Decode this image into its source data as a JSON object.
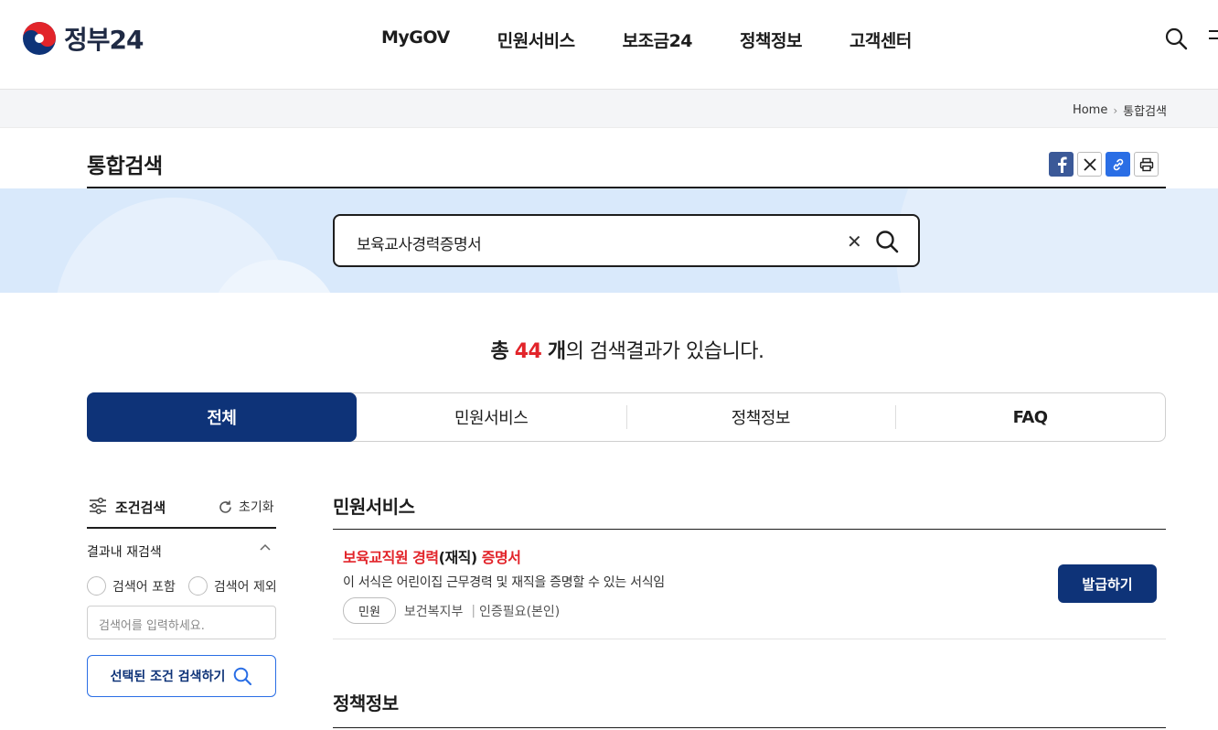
{
  "header": {
    "logo_text": "정부24",
    "nav": [
      "MyGOV",
      "민원서비스",
      "보조금24",
      "정책정보",
      "고객센터"
    ]
  },
  "breadcrumb": {
    "home": "Home",
    "current": "통합검색"
  },
  "page": {
    "title": "통합검색"
  },
  "search": {
    "query": "보육교사경력증명서"
  },
  "summary": {
    "prefix": "총",
    "count": "44",
    "unit": "개",
    "suffix": "의 검색결과가 있습니다."
  },
  "tabs": [
    "전체",
    "민원서비스",
    "정책정보",
    "FAQ"
  ],
  "sidebar": {
    "title": "조건검색",
    "reset": "초기화",
    "research_title": "결과내 재검색",
    "radio_include": "검색어 포함",
    "radio_exclude": "검색어 제외",
    "input_placeholder": "검색어를 입력하세요.",
    "search_button": "선택된 조건 검색하기"
  },
  "results": {
    "section_civil": "민원서비스",
    "item": {
      "title_part1": "보육교직원 경력",
      "title_part2": "(재직)",
      "title_part3": "증명서",
      "description": "이 서식은 어린이집 근무경력 및 재직을 증명할 수 있는 서식임",
      "chip": "민원",
      "agency": "보건복지부",
      "auth": "인증필요(본인)",
      "button": "발급하기"
    },
    "section_policy": "정책정보"
  },
  "colors": {
    "primary": "#0e3378",
    "highlight": "#e2242a",
    "band": "#d9e9fb"
  }
}
